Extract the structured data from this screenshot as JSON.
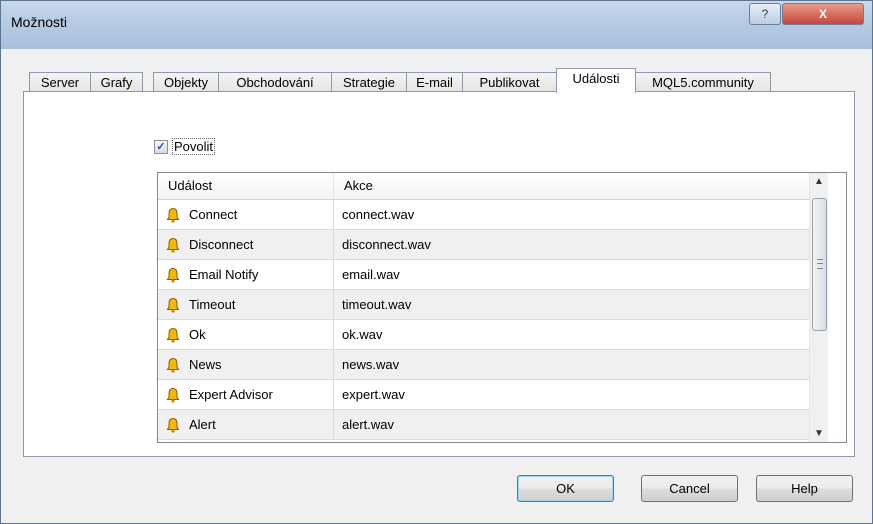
{
  "window": {
    "title": "Možnosti",
    "help_glyph": "?",
    "close_glyph": "X"
  },
  "tabs": [
    {
      "label": "Server",
      "active": false
    },
    {
      "label": "Grafy",
      "active": false
    },
    {
      "label": "Objekty",
      "active": false
    },
    {
      "label": "Obchodování",
      "active": false
    },
    {
      "label": "Strategie",
      "active": false
    },
    {
      "label": "E-mail",
      "active": false
    },
    {
      "label": "Publikovat",
      "active": false
    },
    {
      "label": "Události",
      "active": true
    },
    {
      "label": "MQL5.community",
      "active": false
    }
  ],
  "events_tab": {
    "enable_label": "Povolit",
    "enable_checked": true,
    "columns": {
      "event": "Událost",
      "action": "Akce"
    },
    "rows": [
      {
        "event": "Connect",
        "action": "connect.wav"
      },
      {
        "event": "Disconnect",
        "action": "disconnect.wav"
      },
      {
        "event": "Email Notify",
        "action": "email.wav"
      },
      {
        "event": "Timeout",
        "action": "timeout.wav"
      },
      {
        "event": "Ok",
        "action": "ok.wav"
      },
      {
        "event": "News",
        "action": "news.wav"
      },
      {
        "event": "Expert Advisor",
        "action": "expert.wav"
      },
      {
        "event": "Alert",
        "action": "alert.wav"
      }
    ]
  },
  "buttons": {
    "ok": "OK",
    "cancel": "Cancel",
    "help": "Help"
  },
  "icons": {
    "row_icon": "bell-icon",
    "scroll_up": "scroll-up-arrow-icon",
    "scroll_down": "scroll-down-arrow-icon"
  },
  "colors": {
    "bell_fill": "#f2b80c",
    "title_gradient": "#b7cbe3",
    "close_button": "#c7463a"
  }
}
